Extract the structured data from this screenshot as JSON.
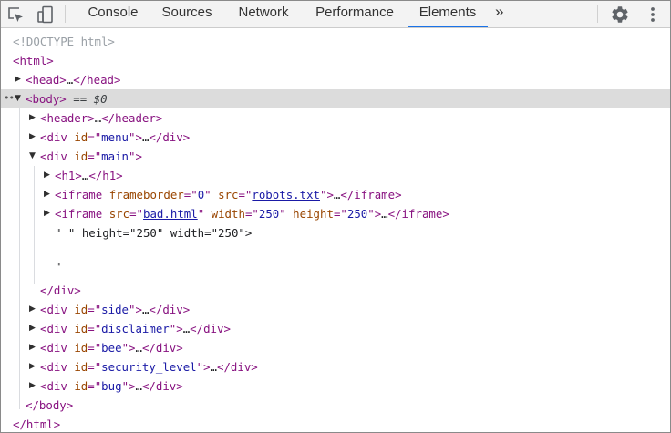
{
  "toolbar": {
    "tabs": [
      {
        "label": "Console"
      },
      {
        "label": "Sources"
      },
      {
        "label": "Network"
      },
      {
        "label": "Performance"
      },
      {
        "label": "Elements"
      }
    ],
    "more_label": "»",
    "active_tab": "Elements",
    "accent_color": "#1a73e8"
  },
  "dom": {
    "doctype": "<!DOCTYPE html>",
    "html_open": "<html>",
    "head": {
      "open": "<head>",
      "ellipsis": "…",
      "close": "</head>"
    },
    "body": {
      "open": "<body>",
      "marker": "== $0",
      "dots": "••",
      "close": "</body>"
    },
    "header": {
      "open": "<header>",
      "ellipsis": "…",
      "close": "</header>"
    },
    "menu": {
      "tag": "div",
      "attr": "id",
      "value": "menu",
      "ellipsis": "…",
      "close": "</div>"
    },
    "main": {
      "tag": "div",
      "attr": "id",
      "value": "main",
      "close": "</div>"
    },
    "h1": {
      "open": "<h1>",
      "ellipsis": "…",
      "close": "</h1>"
    },
    "iframe1": {
      "tag": "iframe",
      "a1": "frameborder",
      "v1": "0",
      "a2": "src",
      "v2": "robots.txt",
      "ellipsis": "…",
      "close": "</iframe>"
    },
    "iframe2": {
      "tag": "iframe",
      "a1": "src",
      "v1": "bad.html",
      "a2": "width",
      "v2": "250",
      "a3": "height",
      "v3": "250",
      "ellipsis": "…",
      "close": "</iframe>"
    },
    "text_node": "\" \" height=\"250\" width=\"250\">",
    "text_quote": "\"",
    "side": {
      "tag": "div",
      "attr": "id",
      "value": "side",
      "ellipsis": "…",
      "close": "</div>"
    },
    "disclaimer": {
      "tag": "div",
      "attr": "id",
      "value": "disclaimer",
      "ellipsis": "…",
      "close": "</div>"
    },
    "bee": {
      "tag": "div",
      "attr": "id",
      "value": "bee",
      "ellipsis": "…",
      "close": "</div>"
    },
    "security_level": {
      "tag": "div",
      "attr": "id",
      "value": "security_level",
      "ellipsis": "…",
      "close": "</div>"
    },
    "bug": {
      "tag": "div",
      "attr": "id",
      "value": "bug",
      "ellipsis": "…",
      "close": "</div>"
    },
    "html_close": "</html>"
  },
  "icons": {
    "inspect": "inspect-element-icon",
    "device": "device-toolbar-icon",
    "settings": "gear-icon",
    "menu": "kebab-menu-icon"
  }
}
